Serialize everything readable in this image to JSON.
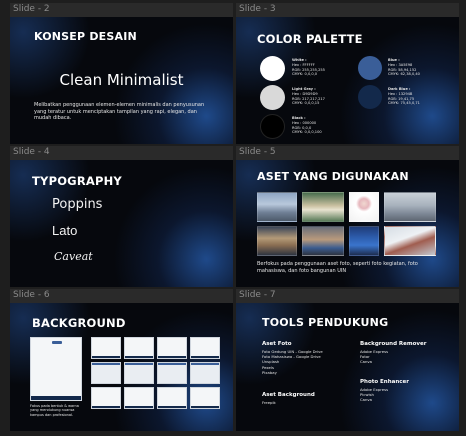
{
  "slides": [
    {
      "label": "Slide - 2",
      "title": "KONSEP DESAIN",
      "subtitle": "Clean Minimalist",
      "body": "Melibatkan penggunaan elemen-elemen minimalis dan penyusunan yang teratur untuk menciptakan tampilan yang rapi, elegan, dan mudah dibaca."
    },
    {
      "label": "Slide - 3",
      "title": "COLOR PALETTE",
      "swatches": [
        {
          "name": "White :",
          "hex": "Hex : FFFFFF",
          "rgb": "RGB: 255,255,255",
          "cmyk": "CMYK: 0,0,0,0",
          "color": "#ffffff"
        },
        {
          "name": "Light Gray :",
          "hex": "Hex : D9D9D9",
          "rgb": "RGB: 217,217,217",
          "cmyk": "CMYK: 0,0,0,15",
          "color": "#d9d9d9"
        },
        {
          "name": "Black :",
          "hex": "Hex : 000000",
          "rgb": "RGB: 0,0,0",
          "cmyk": "CMYK: 0,0,0,100",
          "color": "#000000"
        },
        {
          "name": "Blue :",
          "hex": "Hex : 3A5E98",
          "rgb": "RGB: 58,94,152",
          "cmyk": "CMYK: 62,38,0,40",
          "color": "#3a5e98"
        },
        {
          "name": "Dark Blue :",
          "hex": "Hex : 13294B",
          "rgb": "RGB: 19,41,75",
          "cmyk": "CMYK: 75,45,0,71",
          "color": "#13294b"
        }
      ]
    },
    {
      "label": "Slide - 4",
      "title": "TYPOGRAPHY",
      "fonts": [
        "Poppins",
        "Lato",
        "Caveat"
      ]
    },
    {
      "label": "Slide - 5",
      "title": "ASET YANG DIGUNAKAN",
      "body": "Berfokus pada penggunaan aset foto, seperti foto kegiatan, foto mahasiswa, dan foto bangunan UIN"
    },
    {
      "label": "Slide - 6",
      "title": "BACKGROUND",
      "caption": "Fokus pada bentuk & warna yang mendukung nuansa kampus dan profesional."
    },
    {
      "label": "Slide - 7",
      "title": "TOOLS PENDUKUNG",
      "groups": [
        {
          "heading": "Aset Foto",
          "items": [
            "Foto Gedung UIN - Google Drive",
            "Foto Mahasiswa - Google Drive",
            "Unsplash",
            "Pexels",
            "Pixabay"
          ]
        },
        {
          "heading": "Aset Background",
          "items": [
            "Freepik"
          ]
        },
        {
          "heading": "Background Remover",
          "items": [
            "Adobe Express",
            "Fotor",
            "Canva"
          ]
        },
        {
          "heading": "Photo Enhancer",
          "items": [
            "Adobe Express",
            "Picwish",
            "Canva"
          ]
        }
      ]
    }
  ]
}
